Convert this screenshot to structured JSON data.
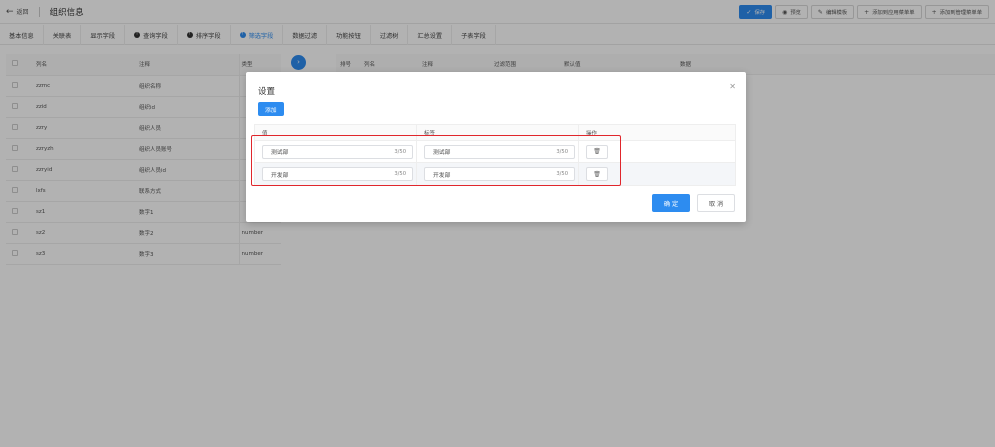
{
  "header": {
    "back_label": "返回",
    "title": "组织信息",
    "actions": [
      {
        "icon": "check-icon",
        "label": "保存"
      },
      {
        "icon": "eye-icon",
        "label": "预览"
      },
      {
        "icon": "edit-icon",
        "label": "编辑模板"
      },
      {
        "icon": "plus-icon",
        "label": "添加到应用菜单单"
      },
      {
        "icon": "plus-icon",
        "label": "添加到管理菜单单"
      }
    ]
  },
  "tabs": [
    {
      "label": "基本信息"
    },
    {
      "label": "关联表"
    },
    {
      "label": "显示字段"
    },
    {
      "label": "查询字段"
    },
    {
      "label": "排序字段"
    },
    {
      "label": "筛选字段"
    },
    {
      "label": "数据过滤"
    },
    {
      "label": "功能按钮"
    },
    {
      "label": "过滤树"
    },
    {
      "label": "汇总设置"
    },
    {
      "label": "子表字段"
    }
  ],
  "left_table": {
    "headers": [
      "列名",
      "注释",
      "类型"
    ],
    "rows": [
      {
        "col": "zzmc",
        "note": "组织名称",
        "type": ""
      },
      {
        "col": "zzid",
        "note": "组织id",
        "type": ""
      },
      {
        "col": "zzry",
        "note": "组织人员",
        "type": ""
      },
      {
        "col": "zzryzh",
        "note": "组织人员账号",
        "type": ""
      },
      {
        "col": "zzryid",
        "note": "组织人员id",
        "type": ""
      },
      {
        "col": "lxfs",
        "note": "联系方式",
        "type": ""
      },
      {
        "col": "sz1",
        "note": "数字1",
        "type": ""
      },
      {
        "col": "sz2",
        "note": "数字2",
        "type": "number"
      },
      {
        "col": "sz3",
        "note": "数字3",
        "type": "number"
      }
    ]
  },
  "right_table": {
    "headers": [
      "排号",
      "列名",
      "注释",
      "过滤范围",
      "默认值",
      "数据"
    ]
  },
  "modal": {
    "title": "设置",
    "add_label": "添加",
    "headers": [
      "值",
      "标签",
      "操作"
    ],
    "rows": [
      {
        "value": "测试部",
        "value_count": "3/50",
        "label": "测试部",
        "label_count": "3/50"
      },
      {
        "value": "开发部",
        "value_count": "3/50",
        "label": "开发部",
        "label_count": "3/50"
      }
    ],
    "ok_label": "确 定",
    "cancel_label": "取 消"
  }
}
